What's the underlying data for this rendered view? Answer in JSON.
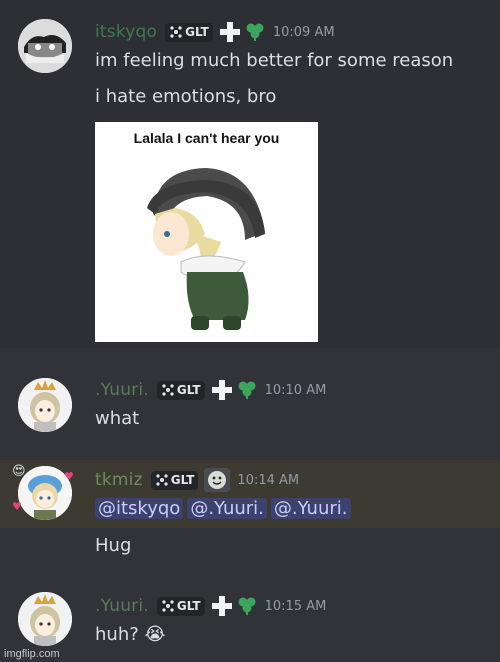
{
  "messages": [
    {
      "username": "itskyqo",
      "username_color": "#3f7a4e",
      "tag": "GLT",
      "time": "10:09 AM",
      "lines": [
        "im feeling much better for some reason",
        "i hate emotions, bro"
      ]
    },
    {
      "image_caption": "Lalala I can't hear you"
    },
    {
      "username": ".Yuuri.",
      "username_color": "#5a7a5c",
      "tag": "GLT",
      "time": "10:10 AM",
      "lines": [
        "what"
      ]
    },
    {
      "username": "tkmiz",
      "username_color": "#6b8e5e",
      "tag": "GLT",
      "time": "10:14 AM",
      "mentions": [
        "@itskyqo",
        "@.Yuuri.",
        "@.Yuuri."
      ],
      "lines": [
        "Hug"
      ]
    },
    {
      "username": ".Yuuri.",
      "username_color": "#5a7a5c",
      "tag": "GLT",
      "time": "10:15 AM",
      "lines": [
        "huh? 😭"
      ]
    }
  ],
  "watermark": "imgflip.com",
  "colors": {
    "background": "#313338",
    "mention_bg": "#3c4270",
    "mention_text": "#c9cdfb",
    "highlight_bg": "#3d3a32"
  }
}
